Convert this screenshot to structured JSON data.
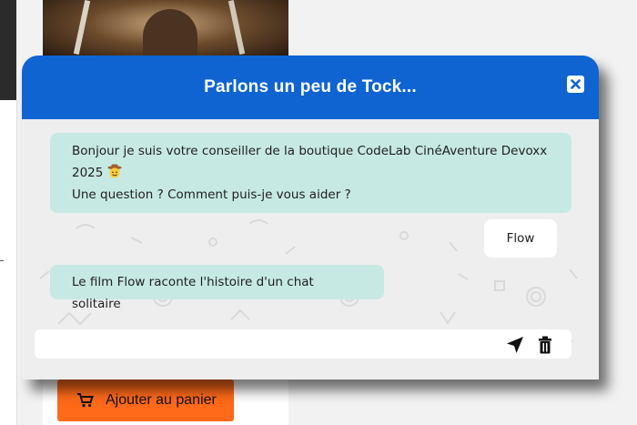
{
  "chat": {
    "title": "Parlons un peu de Tock...",
    "close_icon": "close-icon",
    "messages": [
      {
        "role": "bot",
        "lines": [
          "Bonjour je suis votre conseiller de la boutique CodeLab CinéAventure Devoxx",
          "2025",
          "Une question ? Comment puis-je vous aider ?"
        ],
        "emoji": "cowboy-emoji"
      },
      {
        "role": "user",
        "text": "Flow"
      },
      {
        "role": "bot",
        "text": "Le film Flow raconte l'histoire d'un chat solitaire"
      }
    ],
    "input": {
      "value": "",
      "placeholder": ""
    },
    "send_icon": "send-icon",
    "trash_icon": "trash-icon"
  },
  "page": {
    "add_to_cart_label": "Ajouter au panier",
    "cart_icon": "cart-icon"
  },
  "colors": {
    "header": "#0f64d2",
    "bot_bubble": "#c6e9e3",
    "user_bubble": "#ffffff",
    "cart_button": "#ff6a1a"
  }
}
